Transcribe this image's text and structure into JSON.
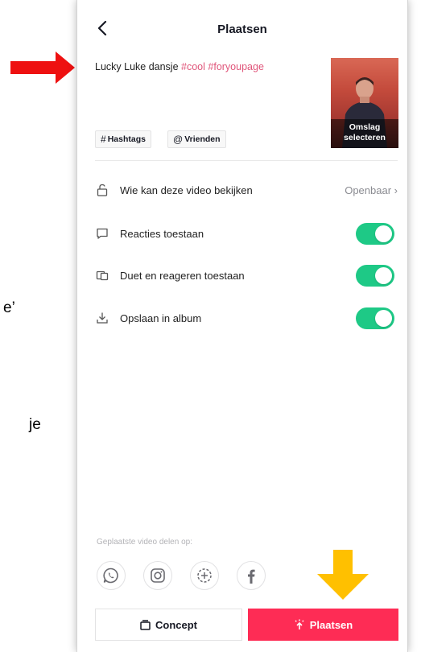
{
  "background": {
    "text_line_1": "e’",
    "text_line_2": "je"
  },
  "header": {
    "title": "Plaatsen",
    "back_icon": "chevron-left-icon"
  },
  "caption": {
    "text": "Lucky Luke dansje ",
    "hashtag_1": "#cool",
    "hashtag_2": "#foryoupage"
  },
  "cover": {
    "label_line_1": "Omslag",
    "label_line_2": "selecteren"
  },
  "chips": {
    "hashtags": "Hashtags",
    "hashtags_symbol": "#",
    "friends": "Vrienden",
    "friends_symbol": "@"
  },
  "settings": {
    "privacy_label": "Wie kan deze video bekijken",
    "privacy_value": "Openbaar",
    "comments_label": "Reacties toestaan",
    "comments_on": true,
    "duet_label": "Duet en reageren toestaan",
    "duet_on": true,
    "save_label": "Opslaan in album",
    "save_on": true
  },
  "share": {
    "label": "Geplaatste video delen op:",
    "icons": [
      "whatsapp-icon",
      "instagram-icon",
      "add-story-icon",
      "facebook-icon"
    ]
  },
  "actions": {
    "concept_label": "Concept",
    "post_label": "Plaatsen"
  },
  "annotations": {
    "red_arrow_color": "#ee1111",
    "yellow_arrow_color": "#ffc000"
  },
  "colors": {
    "accent": "#fe2c55",
    "toggle_on": "#1ec986",
    "hashtag": "#e0557a"
  }
}
